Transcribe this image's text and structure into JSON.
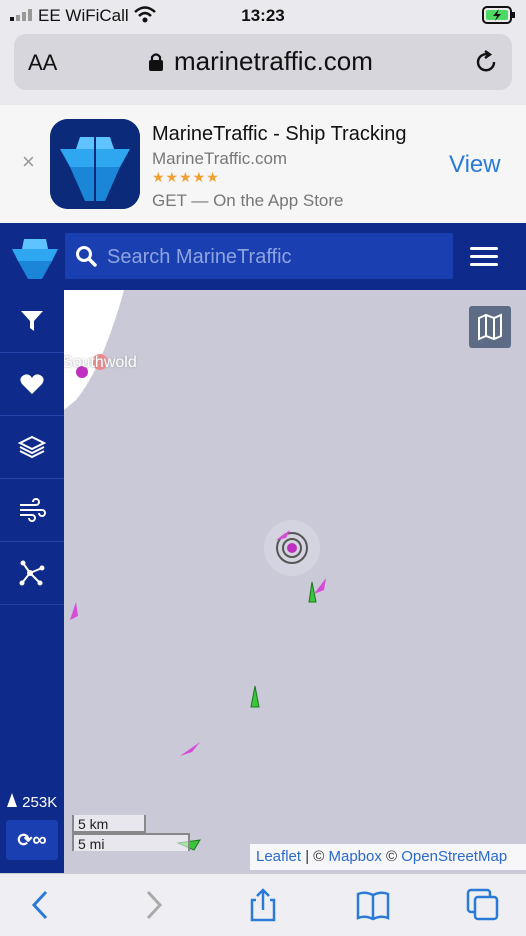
{
  "status": {
    "carrier": "EE WiFiCall",
    "time": "13:23"
  },
  "browser": {
    "text_size": "AA",
    "url": "marinetraffic.com"
  },
  "banner": {
    "title": "MarineTraffic - Ship Tracking",
    "developer": "MarineTraffic.com",
    "rating": 4.5,
    "stars": "★★★★★",
    "get_text": "GET — On the App Store",
    "view_label": "View",
    "close_label": "×"
  },
  "search": {
    "placeholder": "Search MarineTraffic"
  },
  "sidebar": {
    "items": [
      "filter-icon",
      "heart-icon",
      "layers-icon",
      "wind-icon",
      "network-icon"
    ],
    "vessel_count": "253K",
    "loop_label": "∞"
  },
  "map": {
    "town_label": "Southwold",
    "scale_km": "5 km",
    "scale_mi": "5 mi",
    "attribution": {
      "leaflet": "Leaflet",
      "sep1": " | © ",
      "mapbox": "Mapbox",
      "sep2": " © ",
      "osm": "OpenStreetMap"
    }
  },
  "colors": {
    "header": "#0e2a8a",
    "search": "#1a3fb0",
    "map_water": "#c9c9d8",
    "vessel_cargo": "#3cc43c",
    "vessel_pleasure": "#d84ad8",
    "link": "#2a7ad8"
  }
}
